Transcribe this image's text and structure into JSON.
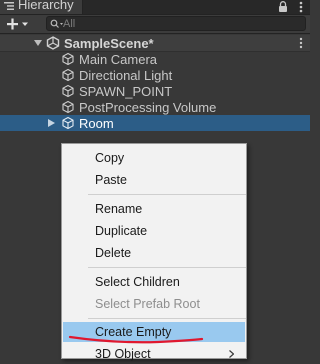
{
  "window": {
    "tab_title": "Hierarchy"
  },
  "toolbar": {
    "add_icon": "plus-dropdown-icon",
    "search": {
      "placeholder": "All",
      "value": ""
    }
  },
  "hierarchy": {
    "scene": {
      "name": "SampleScene*",
      "expanded": true
    },
    "items": [
      {
        "label": "Main Camera",
        "icon": "gameobject-cube-icon",
        "selected": false
      },
      {
        "label": "Directional Light",
        "icon": "gameobject-cube-icon",
        "selected": false
      },
      {
        "label": "SPAWN_POINT",
        "icon": "gameobject-cube-icon",
        "selected": false
      },
      {
        "label": "PostProcessing Volume",
        "icon": "gameobject-cube-icon",
        "selected": false
      },
      {
        "label": "Room",
        "icon": "gameobject-cube-icon",
        "selected": true,
        "has_children": true
      }
    ]
  },
  "context_menu": {
    "items": [
      {
        "label": "Copy",
        "enabled": true
      },
      {
        "label": "Paste",
        "enabled": true
      },
      {
        "label": "Rename",
        "enabled": true
      },
      {
        "label": "Duplicate",
        "enabled": true
      },
      {
        "label": "Delete",
        "enabled": true
      },
      {
        "label": "Select Children",
        "enabled": true
      },
      {
        "label": "Select Prefab Root",
        "enabled": false
      },
      {
        "label": "Create Empty",
        "enabled": true,
        "highlighted": true
      },
      {
        "label": "3D Object",
        "enabled": true,
        "submenu": true
      }
    ]
  },
  "colors": {
    "panel_background": "#383838",
    "selection_blue": "#2c5d87",
    "menu_background": "#f2f2f2",
    "menu_highlight": "#99c9ef",
    "annotation_red": "#e0182f"
  }
}
